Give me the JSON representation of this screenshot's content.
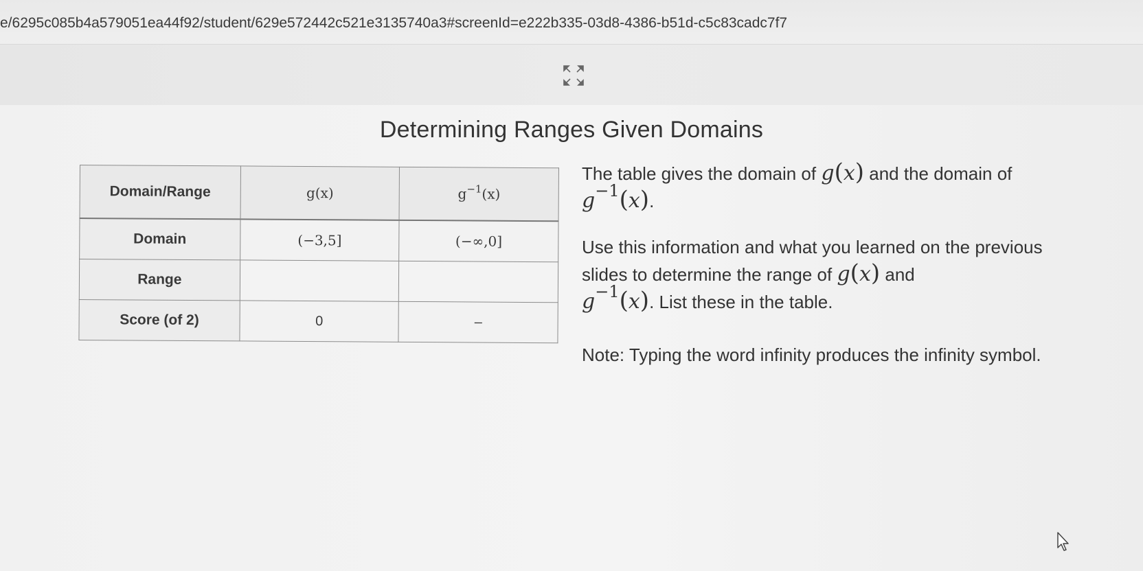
{
  "browser": {
    "url": "e/6295c085b4a579051ea44f92/student/629e572442c521e3135740a3#screenId=e222b335-03d8-4386-b51d-c5c83cadc7f7"
  },
  "toolbar": {
    "expand_icon": "expand-arrows-icon"
  },
  "page": {
    "title": "Determining Ranges Given Domains"
  },
  "table": {
    "headers": [
      "Domain/Range",
      "g(x)",
      "g",
      "−1",
      "(x)"
    ],
    "rows": [
      {
        "label": "Domain",
        "g": "(−3,5]",
        "ginv": "(−∞,0]"
      },
      {
        "label": "Range",
        "g": "",
        "ginv": ""
      },
      {
        "label": "Score (of 2)",
        "g": "0",
        "ginv": "–"
      }
    ]
  },
  "instructions": {
    "p1_before": "The table gives the domain of",
    "p1_mid": "and the domain of",
    "p1_end": ".",
    "p2_before": "Use this information and what you learned on the previous slides to determine the range of",
    "p2_and": "and",
    "p2_end": ". List these in the table.",
    "p3": "Note: Typing the word infinity produces the infinity symbol.",
    "g_letter": "g",
    "x_letter": "x",
    "lparen": "(",
    "rparen": ")",
    "inverse_exp": "−1"
  }
}
